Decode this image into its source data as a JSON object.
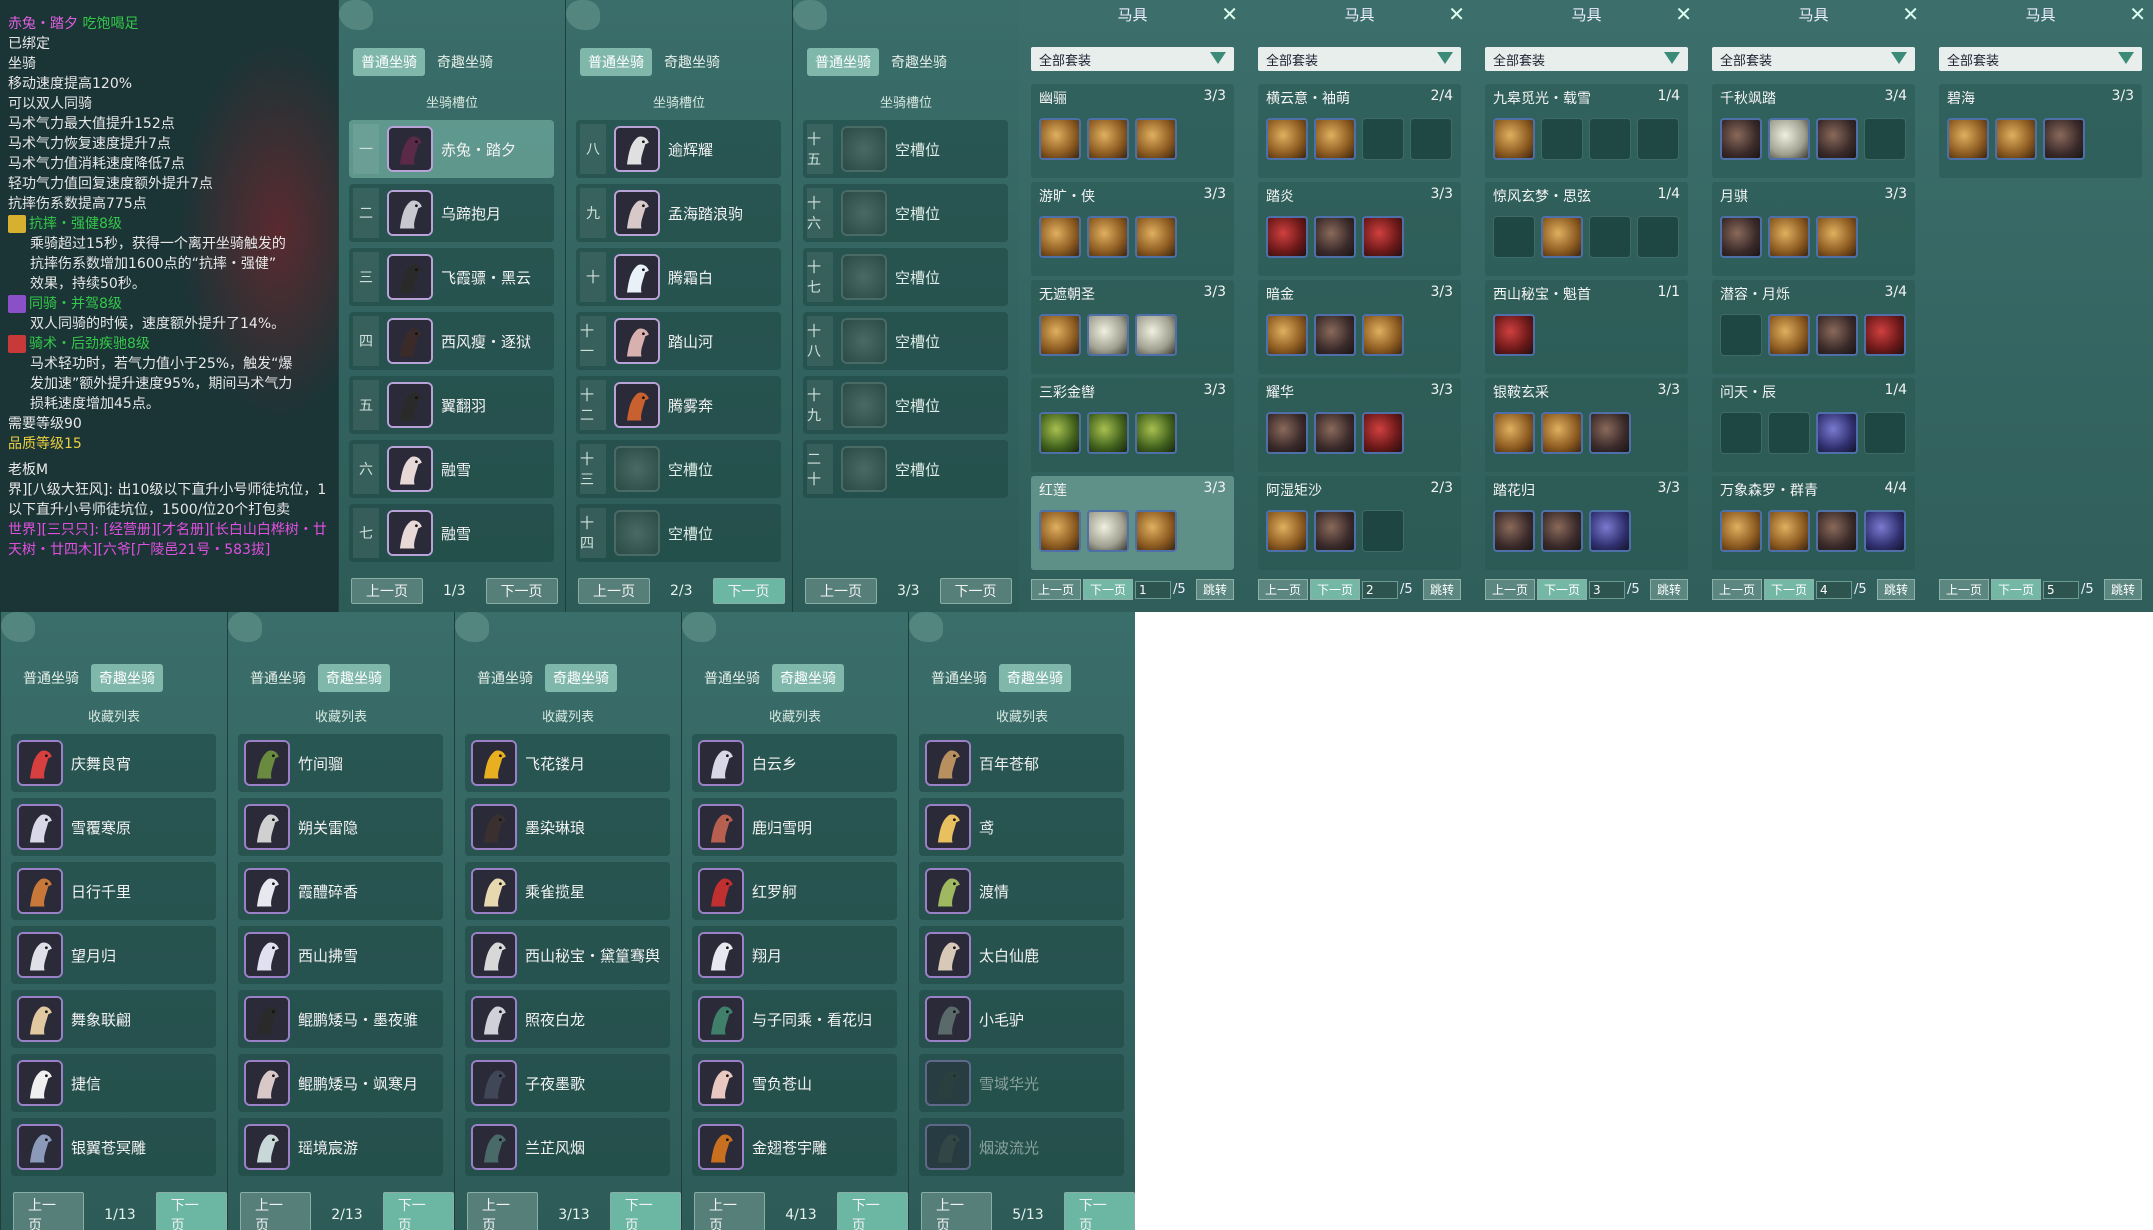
{
  "tooltip": {
    "name": "赤兔・踏夕",
    "name_suffix": "吃饱喝足",
    "lines": [
      "已绑定",
      "坐骑",
      "移动速度提高120%",
      "可以双人同骑",
      "马术气力最大值提升152点",
      "马术气力恢复速度提升7点",
      "马术气力值消耗速度降低7点",
      "轻功气力值回复速度额外提升7点",
      "抗摔伤系数提高775点"
    ],
    "skills": [
      {
        "name": "抗摔・强健8级",
        "desc": [
          "乘骑超过15秒，获得一个离开坐骑触发的",
          "抗摔伤系数增加1600点的“抗摔・强健”",
          "效果，持续50秒。"
        ]
      },
      {
        "name": "同骑・并驾8级",
        "desc": [
          "双人同骑的时候，速度额外提升了14%。"
        ]
      },
      {
        "name": "骑术・后劲疾驰8级",
        "desc": [
          "马术轻功时，若气力值小于25%，触发“爆",
          "发加速”额外提升速度95%，期间马术气力",
          "损耗速度增加45点。"
        ]
      }
    ],
    "req_level": "需要等级90",
    "quality": "品质等级15",
    "chat": [
      "老板M",
      "界][八级大狂风]: 出10级以下直升小号师徒坑位，1",
      "以下直升小号师徒坑位，1500/位20个打包卖",
      "世界][三只只]: [经营册][才名册][长白山白桦树・廿",
      "天树・廿四木][六爷[广陵邑21号・583拔]"
    ]
  },
  "mount_tabs": {
    "normal": "普通坐骑",
    "rare": "奇趣坐骑",
    "slot_title": "坐骑槽位",
    "collect_title": "收藏列表",
    "prev": "上一页",
    "next": "下一页"
  },
  "slots": [
    {
      "page": "1/3",
      "items": [
        {
          "n": "一",
          "name": "赤兔・踏夕",
          "c": "#5a2a48"
        },
        {
          "n": "二",
          "name": "乌蹄抱月",
          "c": "#c8c8d0"
        },
        {
          "n": "三",
          "name": "飞霞骠・黑云",
          "c": "#2a2a2a"
        },
        {
          "n": "四",
          "name": "西风瘦・逐狱",
          "c": "#3a2a2a"
        },
        {
          "n": "五",
          "name": "翼翻羽",
          "c": "#2a2a2a"
        },
        {
          "n": "六",
          "name": "融雪",
          "c": "#e8d8d8"
        },
        {
          "n": "七",
          "name": "融雪",
          "c": "#e8d8d8"
        }
      ]
    },
    {
      "page": "2/3",
      "items": [
        {
          "n": "八",
          "name": "逾辉耀",
          "c": "#e0e0e0"
        },
        {
          "n": "九",
          "name": "孟海踏浪驹",
          "c": "#d8c8c8"
        },
        {
          "n": "十",
          "name": "腾霜白",
          "c": "#e8f0f8"
        },
        {
          "n": "十一",
          "name": "踏山河",
          "c": "#d8b0b0"
        },
        {
          "n": "十二",
          "name": "腾雾奔",
          "c": "#c86030"
        },
        {
          "n": "十三",
          "name": "空槽位",
          "c": ""
        },
        {
          "n": "十四",
          "name": "空槽位",
          "c": ""
        }
      ]
    },
    {
      "page": "3/3",
      "items": [
        {
          "n": "十五",
          "name": "空槽位",
          "c": ""
        },
        {
          "n": "十六",
          "name": "空槽位",
          "c": ""
        },
        {
          "n": "十七",
          "name": "空槽位",
          "c": ""
        },
        {
          "n": "十八",
          "name": "空槽位",
          "c": ""
        },
        {
          "n": "十九",
          "name": "空槽位",
          "c": ""
        },
        {
          "n": "二十",
          "name": "空槽位",
          "c": ""
        }
      ]
    }
  ],
  "gear_title": "马具",
  "gear_filter": "全部套装",
  "gear_foot": {
    "prev": "上一页",
    "next": "下一页",
    "total": "/5",
    "jump": "跳转"
  },
  "gear": [
    {
      "page": "1",
      "sets": [
        {
          "name": "幽骊",
          "count": "3/3",
          "items": [
            "gold",
            "gold",
            "gold"
          ]
        },
        {
          "name": "游旷・侠",
          "count": "3/3",
          "items": [
            "gold",
            "gold",
            "gold"
          ]
        },
        {
          "name": "无遮朝圣",
          "count": "3/3",
          "items": [
            "gold",
            "white",
            "white"
          ]
        },
        {
          "name": "三彩金辔",
          "count": "3/3",
          "items": [
            "green",
            "green",
            "green"
          ]
        },
        {
          "name": "红莲",
          "count": "3/3",
          "items": [
            "gold",
            "white",
            "gold"
          ]
        }
      ]
    },
    {
      "page": "2",
      "sets": [
        {
          "name": "横云意・袖萌",
          "count": "2/4",
          "items": [
            "gold",
            "gold",
            "e",
            "e"
          ]
        },
        {
          "name": "踏炎",
          "count": "3/3",
          "items": [
            "red",
            "dark",
            "red"
          ]
        },
        {
          "name": "暗金",
          "count": "3/3",
          "items": [
            "gold",
            "dark",
            "gold"
          ]
        },
        {
          "name": "耀华",
          "count": "3/3",
          "items": [
            "dark",
            "dark",
            "red"
          ]
        },
        {
          "name": "阿湿矩沙",
          "count": "2/3",
          "items": [
            "gold",
            "dark",
            "e"
          ]
        }
      ]
    },
    {
      "page": "3",
      "sets": [
        {
          "name": "九皋觅光・载雪",
          "count": "1/4",
          "items": [
            "gold",
            "e",
            "e",
            "e"
          ]
        },
        {
          "name": "惊风玄梦・思弦",
          "count": "1/4",
          "items": [
            "e",
            "gold",
            "e",
            "e"
          ]
        },
        {
          "name": "西山秘宝・魁首",
          "count": "1/1",
          "items": [
            "red"
          ]
        },
        {
          "name": "银鞍玄采",
          "count": "3/3",
          "items": [
            "gold",
            "gold",
            "dark"
          ]
        },
        {
          "name": "踏花归",
          "count": "3/3",
          "items": [
            "dark",
            "dark",
            "blue"
          ]
        }
      ]
    },
    {
      "page": "4",
      "sets": [
        {
          "name": "千秋飒踏",
          "count": "3/4",
          "items": [
            "dark",
            "white",
            "dark",
            "e"
          ]
        },
        {
          "name": "月骐",
          "count": "3/3",
          "items": [
            "dark",
            "gold",
            "gold"
          ]
        },
        {
          "name": "潜容・月烁",
          "count": "3/4",
          "items": [
            "e",
            "gold",
            "dark",
            "red"
          ]
        },
        {
          "name": "问天・辰",
          "count": "1/4",
          "items": [
            "e",
            "e",
            "blue",
            "e"
          ]
        },
        {
          "name": "万象森罗・群青",
          "count": "4/4",
          "items": [
            "gold",
            "gold",
            "dark",
            "blue"
          ]
        }
      ]
    },
    {
      "page": "5",
      "sets": [
        {
          "name": "碧海",
          "count": "3/3",
          "items": [
            "gold",
            "gold",
            "dark"
          ]
        }
      ]
    }
  ],
  "collections": [
    {
      "page": "1/13",
      "items": [
        {
          "name": "庆舞良宵",
          "c": "#d84040"
        },
        {
          "name": "雪覆寒原",
          "c": "#d8d8e8"
        },
        {
          "name": "日行千里",
          "c": "#c87838"
        },
        {
          "name": "望月归",
          "c": "#e0e0e8"
        },
        {
          "name": "舞象联翩",
          "c": "#e0c8a0"
        },
        {
          "name": "捷信",
          "c": "#f0f0f0"
        },
        {
          "name": "银翼苍冥雕",
          "c": "#8a9ab8"
        }
      ]
    },
    {
      "page": "2/13",
      "items": [
        {
          "name": "竹间骝",
          "c": "#6a8a40"
        },
        {
          "name": "朔关雷隐",
          "c": "#d0d0d0"
        },
        {
          "name": "霞醴碎香",
          "c": "#e8e8f0"
        },
        {
          "name": "西山拂雪",
          "c": "#e0e0f0"
        },
        {
          "name": "鲲鹏矮马・墨夜骓",
          "c": "#2a2a2a"
        },
        {
          "name": "鲲鹏矮马・飒寒月",
          "c": "#d8c8c8"
        },
        {
          "name": "瑶境宸游",
          "c": "#c8d8d8"
        }
      ]
    },
    {
      "page": "3/13",
      "items": [
        {
          "name": "飞花镂月",
          "c": "#e8b020"
        },
        {
          "name": "墨染琳琅",
          "c": "#3a3030"
        },
        {
          "name": "乘雀揽星",
          "c": "#e8d8b0"
        },
        {
          "name": "西山秘宝・黛篁骞舆",
          "c": "#d8d8d8"
        },
        {
          "name": "照夜白龙",
          "c": "#d0d0d8"
        },
        {
          "name": "子夜墨歌",
          "c": "#404858"
        },
        {
          "name": "兰芷风烟",
          "c": "#4a6a6a"
        }
      ]
    },
    {
      "page": "4/13",
      "items": [
        {
          "name": "白云乡",
          "c": "#d8d8e8"
        },
        {
          "name": "鹿归雪明",
          "c": "#b86050"
        },
        {
          "name": "红罗舸",
          "c": "#c03030"
        },
        {
          "name": "翔月",
          "c": "#e8e8f0"
        },
        {
          "name": "与子同乘・看花归",
          "c": "#40806a"
        },
        {
          "name": "雪负苍山",
          "c": "#e8c8c0"
        },
        {
          "name": "金翅苍宇雕",
          "c": "#c87020"
        }
      ]
    },
    {
      "page": "5/13",
      "items": [
        {
          "name": "百年苍郁",
          "c": "#b89060"
        },
        {
          "name": "鸢",
          "c": "#e8c060"
        },
        {
          "name": "渡情",
          "c": "#a0b860"
        },
        {
          "name": "太白仙鹿",
          "c": "#d8c8b8"
        },
        {
          "name": "小毛驴",
          "c": "#5a6a6a"
        },
        {
          "name": "雪域华光",
          "c": "#303030",
          "dim": true
        },
        {
          "name": "烟波流光",
          "c": "#404040",
          "dim": true
        }
      ]
    }
  ]
}
